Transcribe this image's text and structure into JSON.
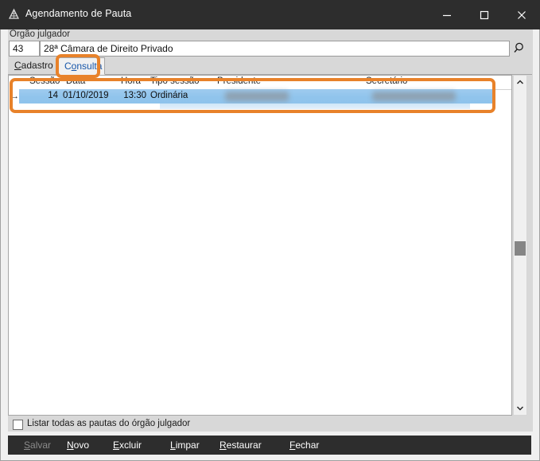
{
  "window": {
    "title": "Agendamento de Pauta",
    "icon": "justice-scales-icon",
    "controls": {
      "minimize": "minimize-icon",
      "maximize": "maximize-icon",
      "close": "close-icon"
    }
  },
  "form": {
    "org_label": "Órgão julgador",
    "org_code": "43",
    "org_name": "28ª Câmara de Direito Privado",
    "search_icon": "magnifier-icon"
  },
  "tabs": [
    {
      "id": "cadastro",
      "label": "Cadastro",
      "mnemonic": "C",
      "rest": "adastro",
      "selected": false
    },
    {
      "id": "consulta",
      "label": "Consulta",
      "mnemonic": "o",
      "pre": "C",
      "rest": "nsulta",
      "selected": true
    }
  ],
  "grid": {
    "columns": [
      "Sessão",
      "Data",
      "Hora",
      "Tipo sessão",
      "Presidente",
      "Secretário"
    ],
    "row_indicator": "→",
    "rows": [
      {
        "sessao": "14",
        "data": "01/10/2019",
        "hora": "13:30",
        "tipo_sessao": "Ordinária",
        "presidente": "",
        "secretario": "",
        "selected": true
      }
    ]
  },
  "scrollbar": {
    "up_icon": "chevron-up-icon",
    "down_icon": "chevron-down-icon",
    "thumb": "scroll-thumb"
  },
  "checkbox": {
    "label": "Listar todas as pautas do órgão julgador",
    "checked": false
  },
  "toolbar": {
    "buttons": [
      {
        "id": "salvar",
        "mnemonic": "S",
        "rest": "alvar",
        "disabled": true
      },
      {
        "id": "novo",
        "mnemonic": "N",
        "rest": "ovo",
        "disabled": false
      },
      {
        "id": "excluir",
        "mnemonic": "E",
        "rest": "xcluir",
        "disabled": false
      },
      {
        "id": "limpar",
        "mnemonic": "L",
        "rest": "impar",
        "disabled": false
      },
      {
        "id": "restaurar",
        "mnemonic": "R",
        "rest": "estaurar",
        "disabled": false
      },
      {
        "id": "fechar",
        "mnemonic": "F",
        "rest": "echar",
        "disabled": false
      }
    ]
  },
  "annotations": {
    "accent_color": "#e8822a",
    "boxes": [
      "consulta-tab-highlight",
      "result-row-highlight"
    ]
  }
}
